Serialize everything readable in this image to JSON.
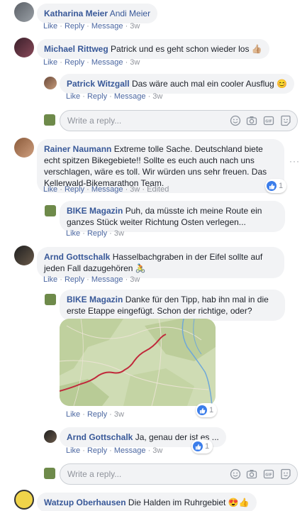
{
  "comments": [
    {
      "name": "Katharina Meier",
      "text": "Andi Meier",
      "actions": {
        "like": "Like",
        "reply": "Reply",
        "message": "Message",
        "time": "3w"
      }
    },
    {
      "name": "Michael Rittweg",
      "text": "Patrick und es geht schon wieder los",
      "emoji": "👍🏼",
      "actions": {
        "like": "Like",
        "reply": "Reply",
        "message": "Message",
        "time": "3w"
      }
    },
    {
      "name": "Patrick Witzgall",
      "text": "Das wäre auch mal ein cooler Ausflug",
      "emoji": "😊",
      "actions": {
        "like": "Like",
        "reply": "Reply",
        "message": "Message",
        "time": "3w"
      }
    },
    {
      "name": "Rainer Naumann",
      "text": "Extreme tolle Sache. Deutschland biete echt spitzen Bikegebiete!! Sollte es euch auch nach uns verschlagen, wäre es toll. Wir würden uns sehr freuen. Das Kellerwald-Bikemarathon Team.",
      "actions": {
        "like": "Like",
        "reply": "Reply",
        "message": "Message",
        "time": "3w",
        "edited": "Edited"
      },
      "likes": "1"
    },
    {
      "name": "BIKE Magazin",
      "text": "Puh, da müsste ich meine Route ein ganzes Stück weiter Richtung Osten verlegen...",
      "actions": {
        "like": "Like",
        "reply": "Reply",
        "time": "3w"
      }
    },
    {
      "name": "Arnd Gottschalk",
      "text": "Hasselbachgraben in der Eifel sollte auf jeden Fall dazugehören",
      "emoji": "🚴",
      "actions": {
        "like": "Like",
        "reply": "Reply",
        "message": "Message",
        "time": "3w"
      }
    },
    {
      "name": "BIKE Magazin",
      "text": "Danke für den Tipp, hab ihn mal in die erste Etappe eingefügt. Schon der richtige, oder?",
      "actions": {
        "like": "Like",
        "reply": "Reply",
        "time": "3w"
      },
      "likes": "1"
    },
    {
      "name": "Arnd Gottschalk",
      "text": "Ja, genau der ist es ...",
      "actions": {
        "like": "Like",
        "reply": "Reply",
        "message": "Message",
        "time": "3w"
      },
      "likes": "1"
    },
    {
      "name": "Watzup Oberhausen",
      "text": "Die Halden im Ruhrgebiet",
      "emoji": "😍👍"
    }
  ],
  "reply_box": {
    "placeholder": "Write a reply..."
  },
  "icons": {
    "emoji": "smiley-icon",
    "camera": "camera-icon",
    "gif": "gif-icon",
    "sticker": "sticker-icon"
  },
  "colors": {
    "link": "#385898",
    "action": "#4b67a1",
    "bubble": "#f2f3f5",
    "like": "#3b7dea"
  }
}
